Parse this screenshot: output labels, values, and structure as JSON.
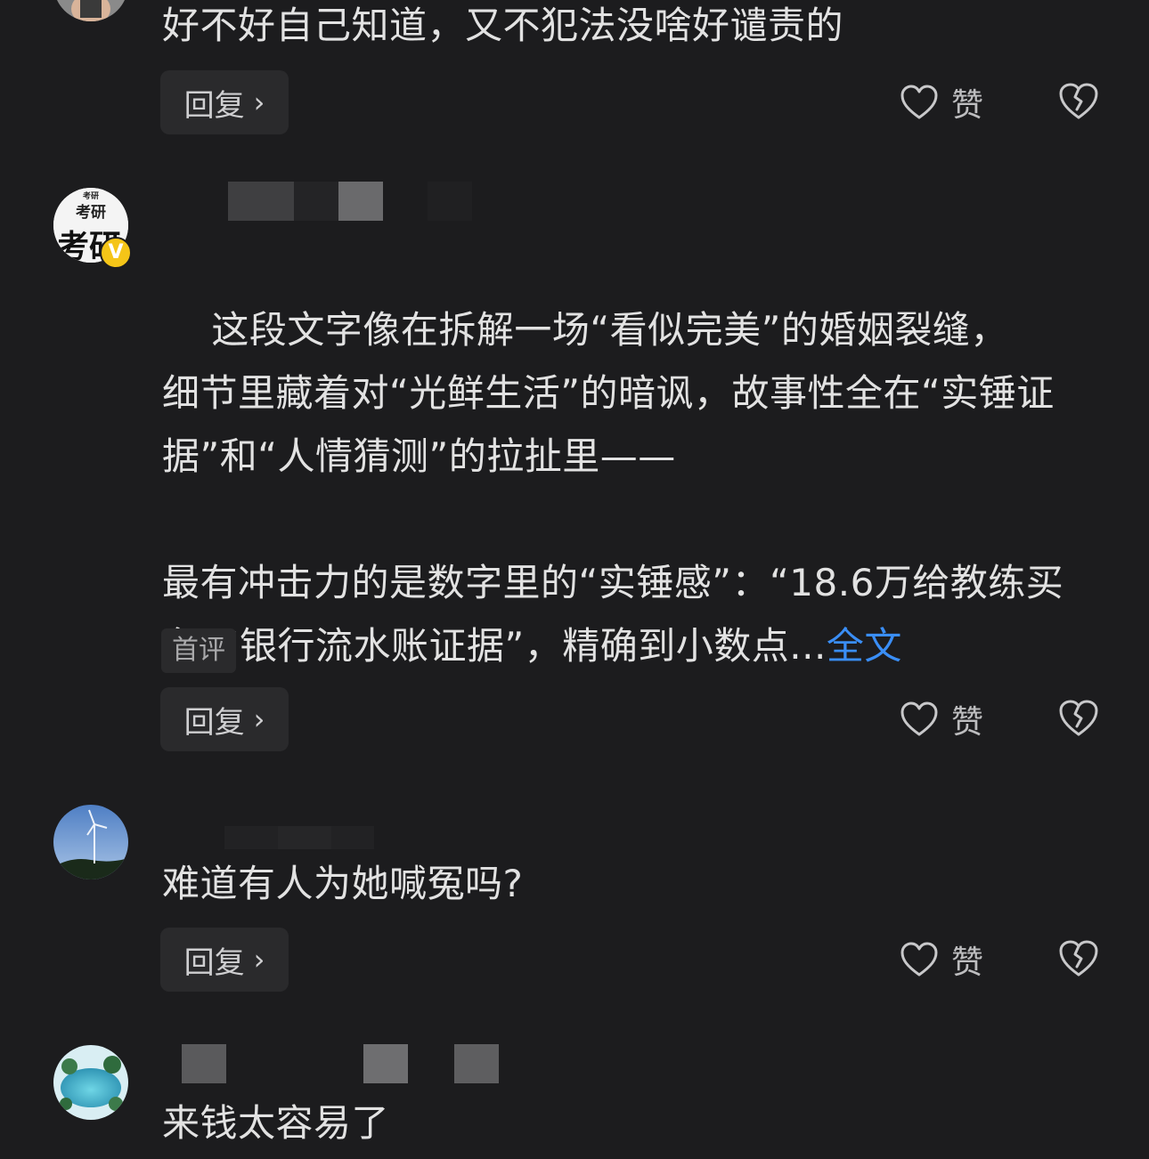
{
  "comments": [
    {
      "text": "好不好自己知道，又不犯法没啥好谴责的",
      "reply_label": "回复",
      "like_label": "赞"
    },
    {
      "avatar_text_top": "考研",
      "avatar_text_mid": "考研",
      "avatar_text_big": "考研",
      "verified_badge": "V",
      "text_part1": "这段文字像在拆解一场“看似完美”的婚姻裂缝，\n细节里藏着对“光鲜生活”的暗讽，故事性全在“实锤证据”和“人情猜测”的拉扯里——\n\n最有冲击力的是数字里的“实锤感”：“18.6万给教练买车”“银行流水账证据”，精确到小数点...",
      "expand_link": "全文",
      "tag": "首评",
      "reply_label": "回复",
      "like_label": "赞"
    },
    {
      "text": "难道有人为她喊冤吗?",
      "reply_label": "回复",
      "like_label": "赞"
    },
    {
      "text": "来钱太容易了"
    }
  ],
  "icons": {
    "heart": "heart-icon",
    "broken_heart": "broken-heart-icon",
    "chevron": "chevron-right-icon"
  },
  "colors": {
    "background": "#1c1c1e",
    "link": "#3a8ef6",
    "button_bg": "#2a2a2c",
    "badge": "#f5c518"
  }
}
